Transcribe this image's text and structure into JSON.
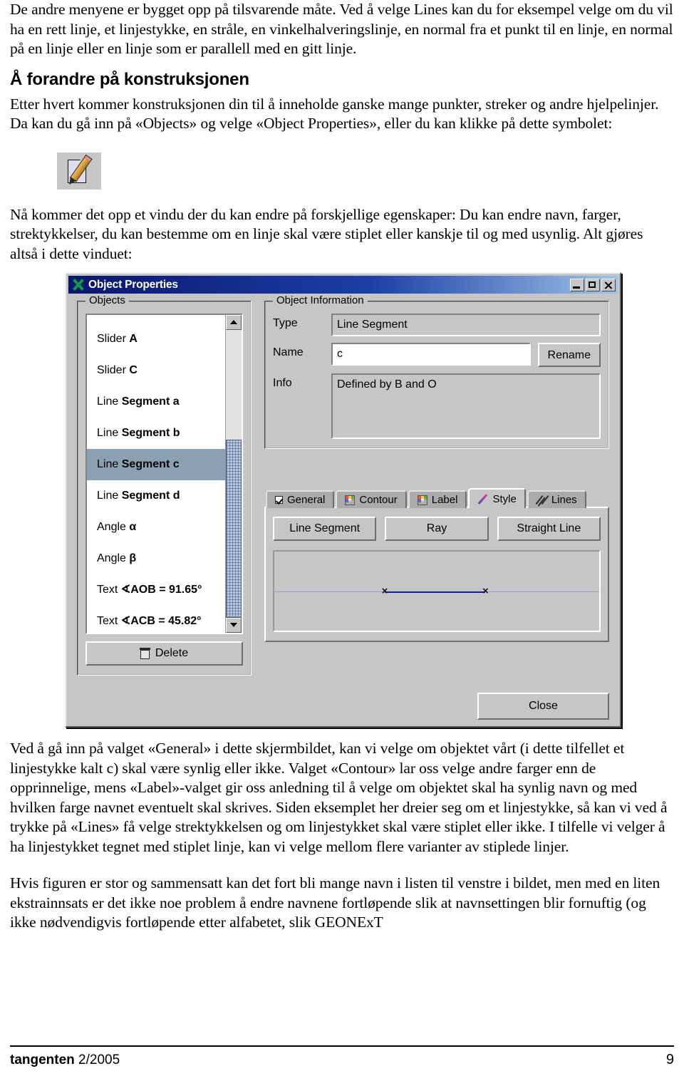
{
  "article": {
    "paragraph_intro": "De andre menyene er bygget opp på tilsvarende måte. Ved å velge Lines kan du for eksempel velge om du vil ha en rett linje, et linjestykke, en stråle, en vinkelhalveringslinje, en normal fra et punkt til en linje, en normal på en linje eller en linje som er parallell med en gitt linje.",
    "heading": "Å forandre på konstruksjonen",
    "paragraph_after_heading": "Etter hvert kommer konstruksjonen din til å inneholde ganske mange punkter, streker og andre hjelpelinjer. Da kan du gå inn på «Objects» og velge «Object Properties», eller du kan klikke på dette symbolet:",
    "paragraph_after_icon": "Nå kommer det opp et vindu der du kan endre på forskjellige egenskaper: Du kan endre navn, farger, strektykkelser, du kan bestemme om en linje skal være stiplet eller kanskje til og med usynlig. Alt gjøres altså i dette vinduet:",
    "paragraph_after_dialog": "Ved å gå inn på valget «General» i dette skjermbildet, kan vi velge om objektet vårt (i dette tilfellet et linjestykke kalt c) skal være synlig eller ikke. Valget «Contour» lar oss velge andre farger enn de opprinnelige, mens «Label»-valget gir oss anledning til å velge om objektet skal ha synlig navn og med hvilken farge navnet eventuelt skal skrives. Siden eksemplet her dreier seg om et linjestykke, så kan vi ved å trykke på «Lines» få velge strektykkelsen og om linjestykket skal være stiplet eller ikke. I tilfelle vi velger å ha linjestykket tegnet med stiplet linje, kan vi velge mellom flere varianter av stiplede linjer.",
    "paragraph_final": "Hvis figuren er stor og sammensatt kan det fort bli mange navn i listen til venstre i bildet, men med en liten ekstrainnsats er det ikke noe problem å endre navnene fortløpende slik at navnsettingen blir fornuftig (og ikke nødvendigvis fortløpende etter alfabetet, slik GEONExT"
  },
  "toolbar_icon": {
    "name": "object-properties-icon",
    "depicts": "document-with-pencil"
  },
  "dialog": {
    "title": "Object Properties",
    "app_icon": "green-x-icon",
    "window_buttons": {
      "minimize": "minimize-icon",
      "maximize": "maximize-icon",
      "close": "close-icon"
    },
    "objects_group": {
      "title": "Objects",
      "items": [
        {
          "prefix": "Slider ",
          "bold": "A",
          "selected": false
        },
        {
          "prefix": "Slider ",
          "bold": "C",
          "selected": false
        },
        {
          "prefix": "Line ",
          "bold": "Segment a",
          "selected": false
        },
        {
          "prefix": "Line ",
          "bold": "Segment b",
          "selected": false
        },
        {
          "prefix": "Line ",
          "bold": "Segment c",
          "selected": true
        },
        {
          "prefix": "Line ",
          "bold": "Segment d",
          "selected": false
        },
        {
          "prefix": "Angle ",
          "bold": "α",
          "selected": false
        },
        {
          "prefix": "Angle ",
          "bold": "β",
          "selected": false
        },
        {
          "prefix": "Text ",
          "bold": "∢AOB = 91.65°",
          "selected": false
        },
        {
          "prefix": "Text ",
          "bold": "∢ACB = 45.82°",
          "selected": false
        }
      ],
      "delete_label": "Delete",
      "delete_icon": "trash-icon",
      "scrollbar": {
        "up_icon": "chevron-up-icon",
        "down_icon": "chevron-down-icon"
      }
    },
    "object_information": {
      "title": "Object Information",
      "type_label": "Type",
      "type_value": "Line Segment",
      "name_label": "Name",
      "name_value": "c",
      "rename_label": "Rename",
      "info_label": "Info",
      "info_value": "Defined by B and O"
    },
    "tabs": [
      {
        "label": "General",
        "icon": "checkbox-icon",
        "active": false
      },
      {
        "label": "Contour",
        "icon": "palette-icon",
        "active": false
      },
      {
        "label": "Label",
        "icon": "palette-icon",
        "active": false
      },
      {
        "label": "Style",
        "icon": "pen-icon",
        "active": true
      },
      {
        "label": "Lines",
        "icon": "diagonal-lines-icon",
        "active": false
      }
    ],
    "style_panel": {
      "buttons": [
        "Line Segment",
        "Ray",
        "Straight Line"
      ],
      "preview": {
        "marker_glyph": "×",
        "line_color": "#1a1a9e",
        "axis_color": "#9aa2c8"
      }
    },
    "close_label": "Close"
  },
  "footer": {
    "journal": "tangenten",
    "issue": " 2/2005",
    "page_number": "9"
  }
}
